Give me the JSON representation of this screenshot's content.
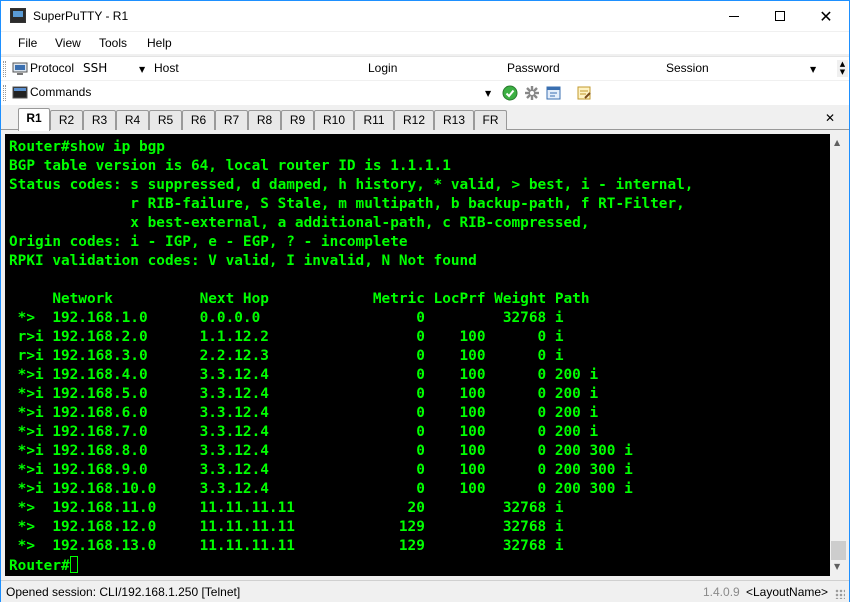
{
  "window": {
    "title": "SuperPuTTY - R1"
  },
  "menu": [
    "File",
    "View",
    "Tools",
    "Help"
  ],
  "toolbar1": {
    "protocol_label": "Protocol",
    "protocol_value": "SSH",
    "host_label": "Host",
    "host_value": "",
    "login_label": "Login",
    "login_value": "",
    "password_label": "Password",
    "password_value": "",
    "session_label": "Session",
    "session_value": ""
  },
  "toolbar2": {
    "commands_label": "Commands",
    "commands_value": ""
  },
  "tabs": [
    "R1",
    "R2",
    "R3",
    "R4",
    "R5",
    "R6",
    "R7",
    "R8",
    "R9",
    "R10",
    "R11",
    "R12",
    "R13",
    "FR"
  ],
  "active_tab": "R1",
  "terminal": {
    "lines": [
      "Router#show ip bgp",
      "BGP table version is 64, local router ID is 1.1.1.1",
      "Status codes: s suppressed, d damped, h history, * valid, > best, i - internal,",
      "              r RIB-failure, S Stale, m multipath, b backup-path, f RT-Filter,",
      "              x best-external, a additional-path, c RIB-compressed,",
      "Origin codes: i - IGP, e - EGP, ? - incomplete",
      "RPKI validation codes: V valid, I invalid, N Not found",
      "",
      "     Network          Next Hop            Metric LocPrf Weight Path",
      " *>  192.168.1.0      0.0.0.0                  0         32768 i",
      " r>i 192.168.2.0      1.1.12.2                 0    100      0 i",
      " r>i 192.168.3.0      2.2.12.3                 0    100      0 i",
      " *>i 192.168.4.0      3.3.12.4                 0    100      0 200 i",
      " *>i 192.168.5.0      3.3.12.4                 0    100      0 200 i",
      " *>i 192.168.6.0      3.3.12.4                 0    100      0 200 i",
      " *>i 192.168.7.0      3.3.12.4                 0    100      0 200 i",
      " *>i 192.168.8.0      3.3.12.4                 0    100      0 200 300 i",
      " *>i 192.168.9.0      3.3.12.4                 0    100      0 200 300 i",
      " *>i 192.168.10.0     3.3.12.4                 0    100      0 200 300 i",
      " *>  192.168.11.0     11.11.11.11             20         32768 i",
      " *>  192.168.12.0     11.11.11.11            129         32768 i",
      " *>  192.168.13.0     11.11.11.11            129         32768 i"
    ],
    "prompt": "Router#"
  },
  "status": {
    "text": "Opened session: CLI/192.168.1.250 [Telnet]",
    "version": "1.4.0.9",
    "layout": "<LayoutName>"
  },
  "colors": {
    "terminal_fg": "#00ff00",
    "terminal_bg": "#000000",
    "window_border": "#1e90ff"
  }
}
